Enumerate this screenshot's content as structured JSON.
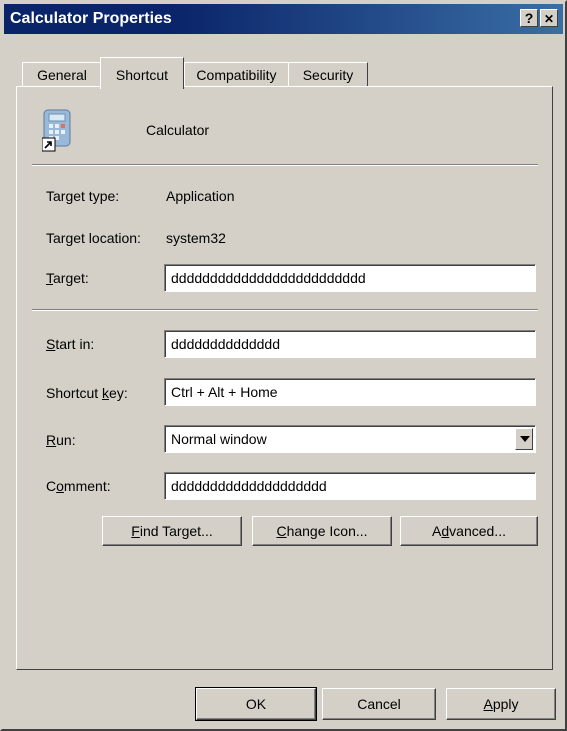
{
  "window": {
    "title": "Calculator Properties",
    "help_glyph": "?",
    "close_glyph": "✕"
  },
  "tabs": [
    {
      "label": "General"
    },
    {
      "label": "Shortcut"
    },
    {
      "label": "Compatibility"
    },
    {
      "label": "Security"
    }
  ],
  "shortcut": {
    "app_name": "Calculator",
    "target_type_label": "Target type:",
    "target_type_value": "Application",
    "target_location_label": "Target location:",
    "target_location_value": "system32",
    "target_label_u": "T",
    "target_label_rest": "arget:",
    "target_value": "ddddddddddddddddddddddddd",
    "start_in_label_u": "S",
    "start_in_label_rest": "tart in:",
    "start_in_value": "dddddddddddddd",
    "shortcut_key_label_pre": "Shortcut ",
    "shortcut_key_label_u": "k",
    "shortcut_key_label_rest": "ey:",
    "shortcut_key_value": "Ctrl + Alt + Home",
    "run_label_u": "R",
    "run_label_rest": "un:",
    "run_value": "Normal window",
    "comment_label_pre": "C",
    "comment_label_u": "o",
    "comment_label_rest": "mment:",
    "comment_value": "dddddddddddddddddddd",
    "find_target_u": "F",
    "find_target_rest": "ind Target...",
    "change_icon_u": "C",
    "change_icon_rest": "hange Icon...",
    "advanced_pre": "A",
    "advanced_u": "d",
    "advanced_rest": "vanced..."
  },
  "footer": {
    "ok_label": "OK",
    "cancel_label": "Cancel",
    "apply_u": "A",
    "apply_rest": "pply"
  }
}
